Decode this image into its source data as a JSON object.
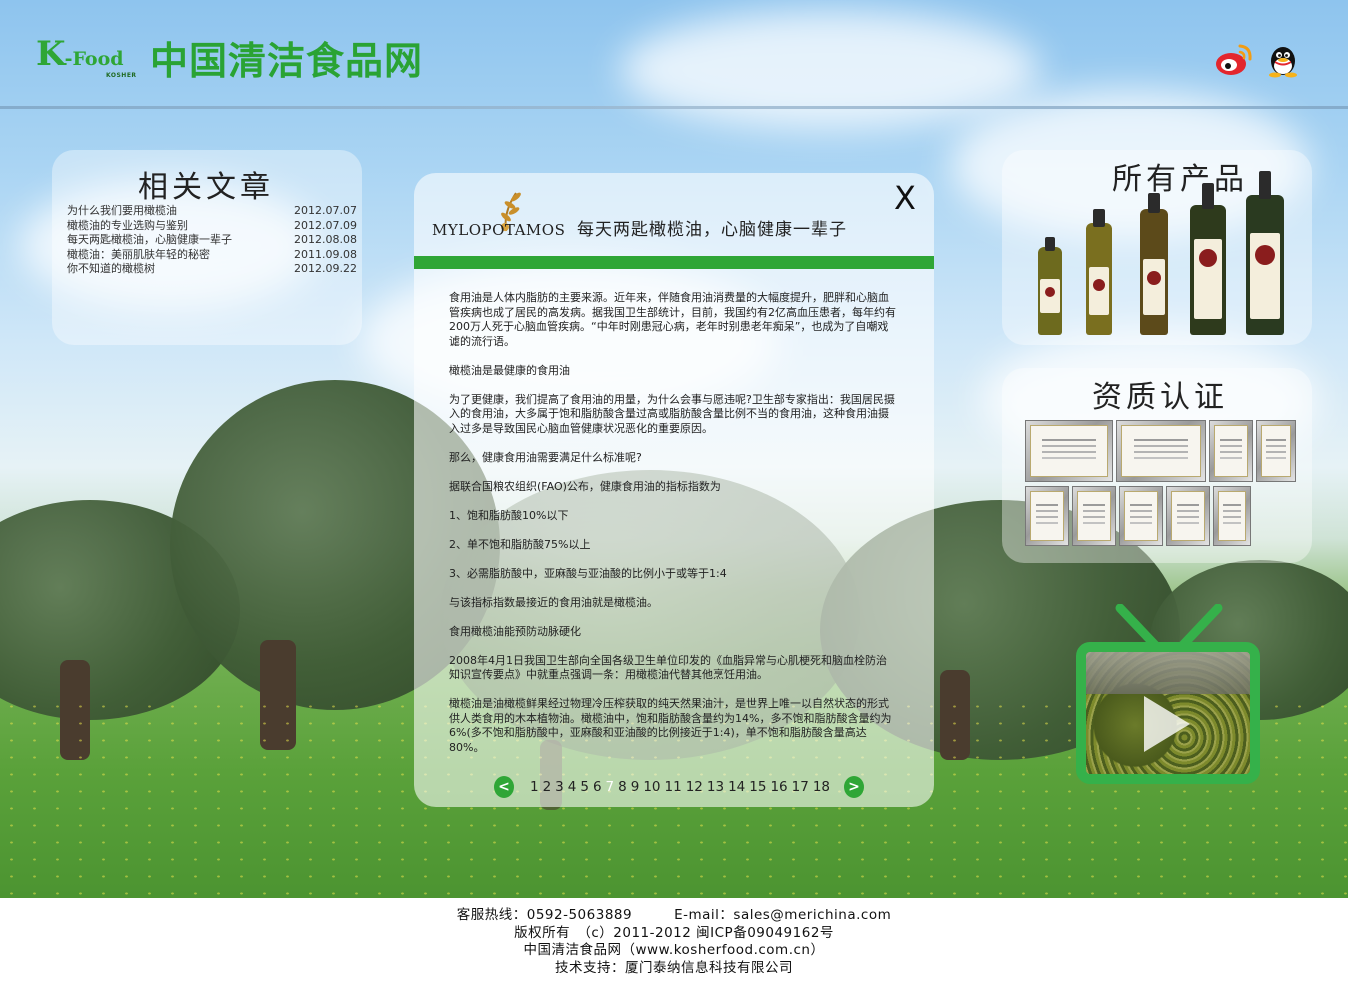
{
  "header": {
    "logo_k": "K",
    "logo_food": "-Food",
    "logo_kosher": "KOSHER",
    "site_title": "中国清洁食品网",
    "icons": [
      "weibo-icon",
      "qq-icon"
    ]
  },
  "related_articles": {
    "title": "相关文章",
    "items": [
      {
        "title": "为什么我们要用橄榄油",
        "date": "2012.07.07"
      },
      {
        "title": "橄榄油的专业选购与鉴别",
        "date": "2012.07.09"
      },
      {
        "title": "每天两匙橄榄油，心脑健康一辈子",
        "date": "2012.08.08"
      },
      {
        "title": "橄榄油：美丽肌肤年轻的秘密",
        "date": "2011.09.08"
      },
      {
        "title": "你不知道的橄榄树",
        "date": "2012.09.22"
      }
    ]
  },
  "products": {
    "title": "所有产品"
  },
  "certifications": {
    "title": "资质认证"
  },
  "article": {
    "brand": "MYLOPOTAMOS",
    "slogan": "每天两匙橄榄油，心脑健康一辈子",
    "close_label": "X",
    "paragraphs": [
      "食用油是人体内脂肪的主要来源。近年来，伴随食用油消费量的大幅度提升，肥胖和心脑血管疾病也成了居民的高发病。据我国卫生部统计，目前，我国约有2亿高血压患者，每年约有200万人死于心脑血管疾病。“中年时刚患冠心病，老年时别患老年痴呆”，也成为了自嘲戏谑的流行语。",
      "橄榄油是最健康的食用油",
      "为了更健康，我们提高了食用油的用量，为什么会事与愿违呢?卫生部专家指出：我国居民摄入的食用油，大多属于饱和脂肪酸含量过高或脂肪酸含量比例不当的食用油，这种食用油摄入过多是导致国民心脑血管健康状况恶化的重要原因。",
      "那么，健康食用油需要满足什么标准呢?",
      "据联合国粮农组织(FAO)公布，健康食用油的指标指数为",
      "1、饱和脂肪酸10%以下",
      "2、单不饱和脂肪酸75%以上",
      "3、必需脂肪酸中，亚麻酸与亚油酸的比例小于或等于1:4",
      "与该指标指数最接近的食用油就是橄榄油。",
      "食用橄榄油能预防动脉硬化",
      "2008年4月1日我国卫生部向全国各级卫生单位印发的《血脂异常与心肌梗死和脑血栓防治知识宣传要点》中就重点强调一条：用橄榄油代替其他烹饪用油。",
      "橄榄油是油橄榄鲜果经过物理冷压榨获取的纯天然果油汁，是世界上唯一以自然状态的形式供人类食用的木本植物油。橄榄油中，饱和脂肪酸含量约为14%，多不饱和脂肪酸含量约为6%(多不饱和脂肪酸中，亚麻酸和亚油酸的比例接近于1:4)，单不饱和脂肪酸含量高达80%。"
    ],
    "pager": {
      "prev": "<",
      "next": ">",
      "pages": [
        "1",
        "2",
        "3",
        "4",
        "5",
        "6",
        "7",
        "8",
        "9",
        "10",
        "11",
        "12",
        "13",
        "14",
        "15",
        "16",
        "17",
        "18"
      ],
      "current": "7"
    }
  },
  "video": {
    "icon": "play-icon"
  },
  "footer": {
    "line1": "客服热线：0592-5063889　　　E-mail：sales@merichina.com",
    "line2": "版权所有　（c）2011-2012 闽ICP备09049162号",
    "line3": "中国清洁食品网（www.kosherfood.com.cn）",
    "line4": "技术支持：厦门泰纳信息科技有限公司"
  },
  "colors": {
    "brand_green": "#2fa636",
    "accent_red": "#e3262d"
  }
}
